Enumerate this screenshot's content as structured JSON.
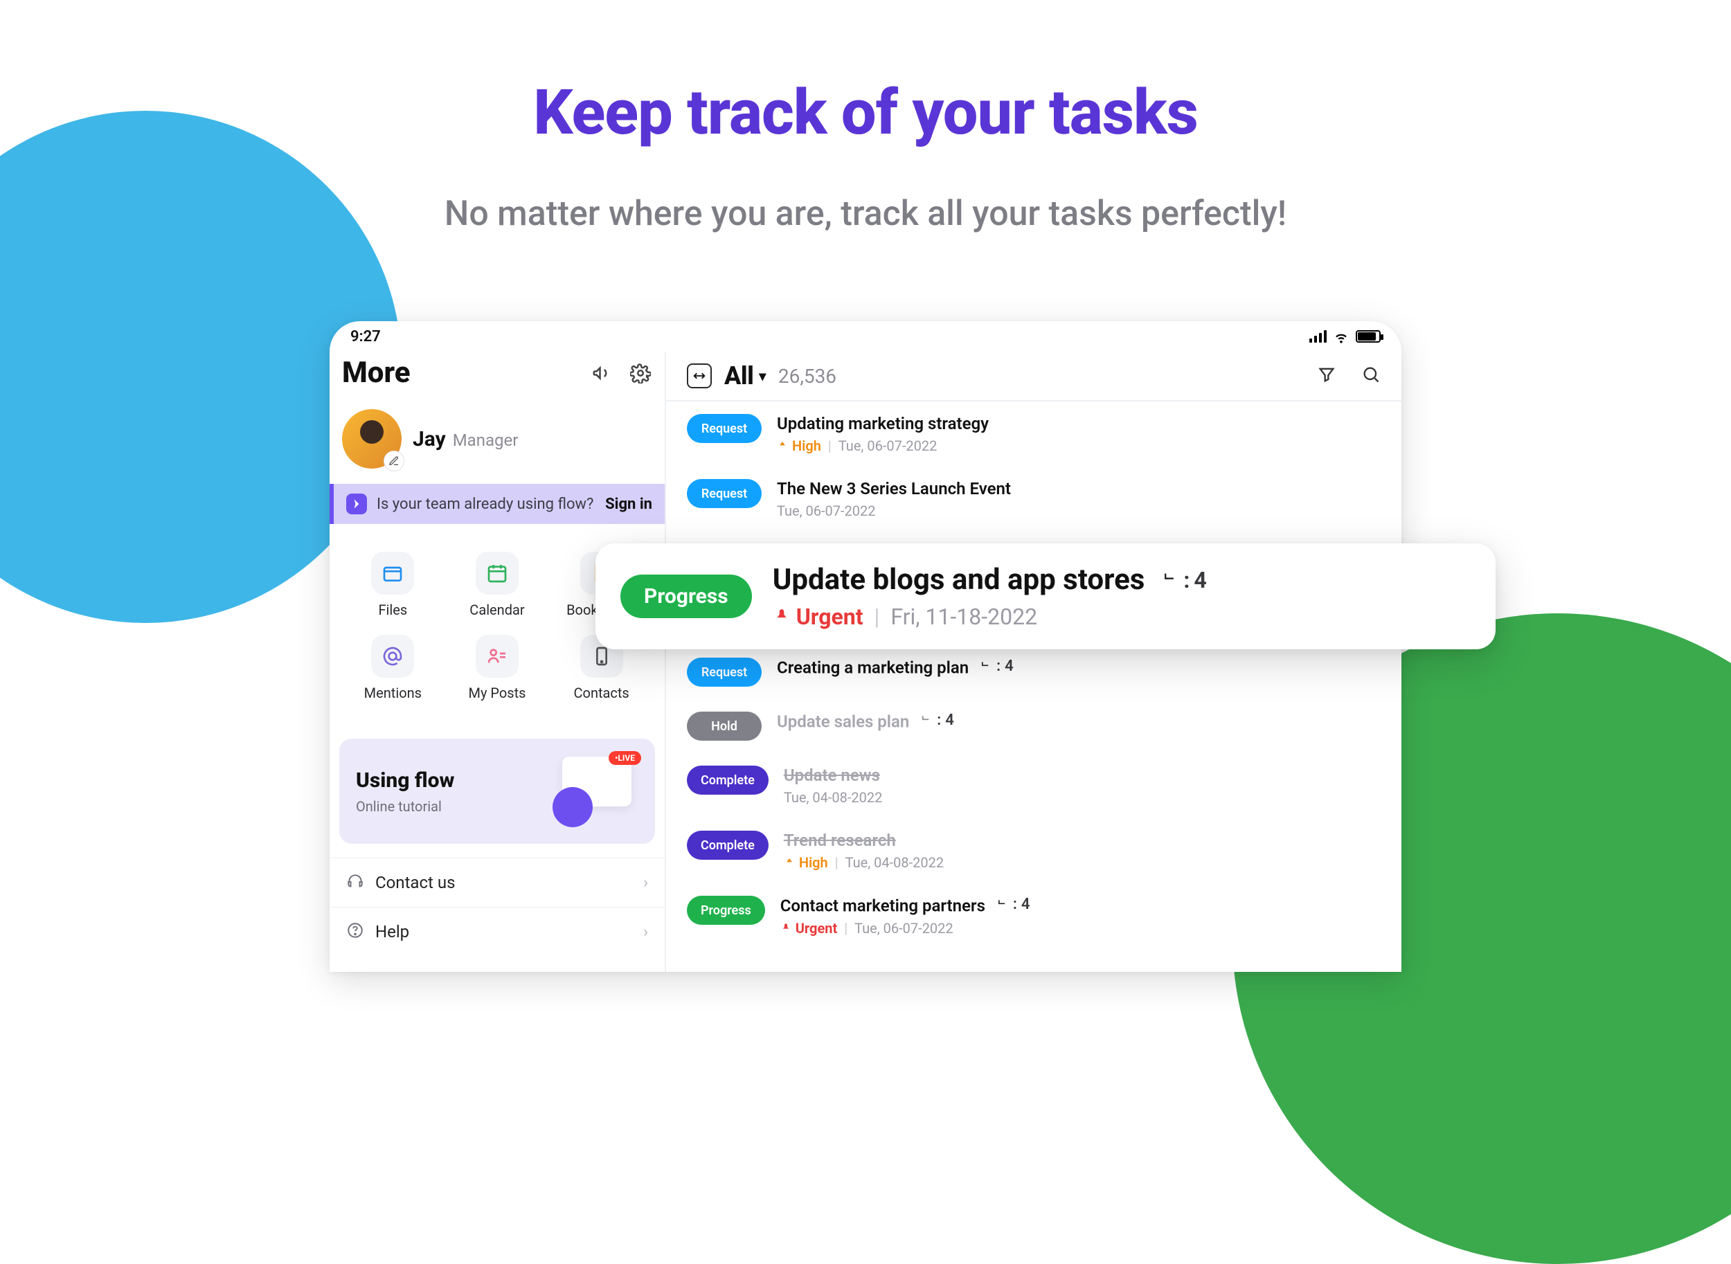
{
  "hero": {
    "title": "Keep track of your tasks",
    "subtitle": "No matter where you are, track all your tasks perfectly!"
  },
  "status_bar": {
    "time": "9:27"
  },
  "left": {
    "title": "More",
    "user": {
      "name": "Jay",
      "role": "Manager"
    },
    "banner": {
      "text": "Is your team already using flow?",
      "action": "Sign in"
    },
    "grid": {
      "files": "Files",
      "calendar": "Calendar",
      "bookmarks": "Bookmarks",
      "mentions": "Mentions",
      "myposts": "My Posts",
      "contacts": "Contacts"
    },
    "tutorial": {
      "title": "Using flow",
      "subtitle": "Online tutorial",
      "live": "•LIVE"
    },
    "menu": {
      "contact": "Contact us",
      "help": "Help"
    }
  },
  "right": {
    "filter_label": "All",
    "count": "26,536"
  },
  "tasks": [
    {
      "status": "Request",
      "pill_class": "request",
      "title": "Updating marketing strategy",
      "priority": "high",
      "priority_label": "High",
      "date": "Tue, 06-07-2022"
    },
    {
      "status": "Request",
      "pill_class": "request",
      "title": "The New 3 Series Launch Event",
      "date": "Tue, 06-07-2022"
    },
    {
      "status": "Request",
      "pill_class": "request",
      "title": "Creating a marketing plan",
      "subtasks": "4"
    },
    {
      "status": "Hold",
      "pill_class": "hold",
      "title": "Update sales plan",
      "subtasks": "4",
      "muted": true
    },
    {
      "status": "Complete",
      "pill_class": "complete",
      "title": "Update news",
      "date": "Tue, 04-08-2022",
      "strike": true
    },
    {
      "status": "Complete",
      "pill_class": "complete",
      "title": "Trend research",
      "priority": "high",
      "priority_label": "High",
      "date": "Tue, 04-08-2022",
      "strike": true
    },
    {
      "status": "Progress",
      "pill_class": "progress",
      "title": "Contact marketing partners",
      "subtasks": "4",
      "priority": "urgent",
      "priority_label": "Urgent",
      "date": "Tue, 06-07-2022"
    }
  ],
  "highlight": {
    "status": "Progress",
    "title": "Update blogs and app stores",
    "subtasks": "4",
    "priority_label": "Urgent",
    "date": "Fri, 11-18-2022"
  },
  "meta_labels": {
    "subtask_sep": ":"
  }
}
